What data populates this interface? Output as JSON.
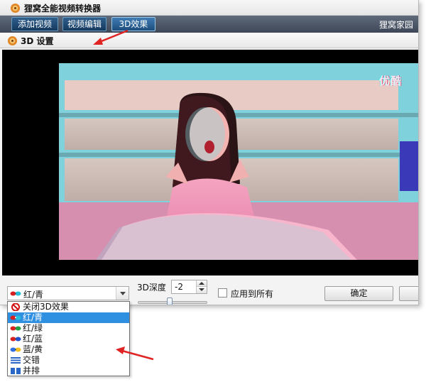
{
  "window": {
    "title": "狸窝全能视频转换器",
    "brand": "狸窝家园"
  },
  "toolbar": {
    "tabs": [
      {
        "label": "添加视频"
      },
      {
        "label": "视频编辑"
      },
      {
        "label": "3D效果",
        "active": true
      }
    ]
  },
  "section": {
    "title": "3D 设置"
  },
  "preview": {
    "watermark": "优酷"
  },
  "controls": {
    "mode_value": "红/青",
    "depth_label": "3D深度",
    "depth_value": "-2",
    "depth_slider_fraction": 0.45,
    "apply_all_label": "应用到所有",
    "apply_all_checked": false,
    "ok_label": "确定"
  },
  "dropdown": {
    "options": [
      {
        "label": "关闭3D效果",
        "icon": "no-entry-icon"
      },
      {
        "label": "红/青",
        "icon": "red-cyan-glasses-icon",
        "selected": true
      },
      {
        "label": "红/绿",
        "icon": "red-green-glasses-icon"
      },
      {
        "label": "红/蓝",
        "icon": "red-blue-glasses-icon"
      },
      {
        "label": "蓝/黄",
        "icon": "blue-yellow-glasses-icon"
      },
      {
        "label": "交错",
        "icon": "interlaced-icon"
      },
      {
        "label": "并排",
        "icon": "side-by-side-icon"
      }
    ]
  },
  "colors": {
    "toolbar_bg": "#4a5566",
    "tab_bg": "#1d4d7e",
    "selection": "#2f8fe0",
    "annotation": "#e02424"
  }
}
